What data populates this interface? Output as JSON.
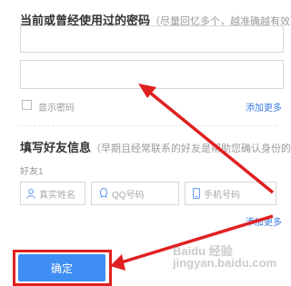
{
  "password_section": {
    "title": "当前或曾经使用过的密码",
    "hint": "（尽量回忆多个，越准确越有效）",
    "input_1_value": "",
    "input_2_value": "",
    "show_password_label": "显示密码",
    "add_more_label": "添加更多"
  },
  "friend_section": {
    "title": "填写好友信息",
    "hint": "（早期且经常联系的好友是帮助您确认身份的",
    "friend_label": "好友1",
    "name_placeholder": "真实姓名",
    "qq_placeholder": "QQ号码",
    "phone_placeholder": "手机号码",
    "add_more_label": "添加更多"
  },
  "confirm_button_label": "确定",
  "watermark": "Baidu 经验 jingyan.baidu.com",
  "colors": {
    "primary_blue": "#3f8ef4",
    "link_blue": "#3d7be0",
    "annotation_red": "#e02020"
  }
}
